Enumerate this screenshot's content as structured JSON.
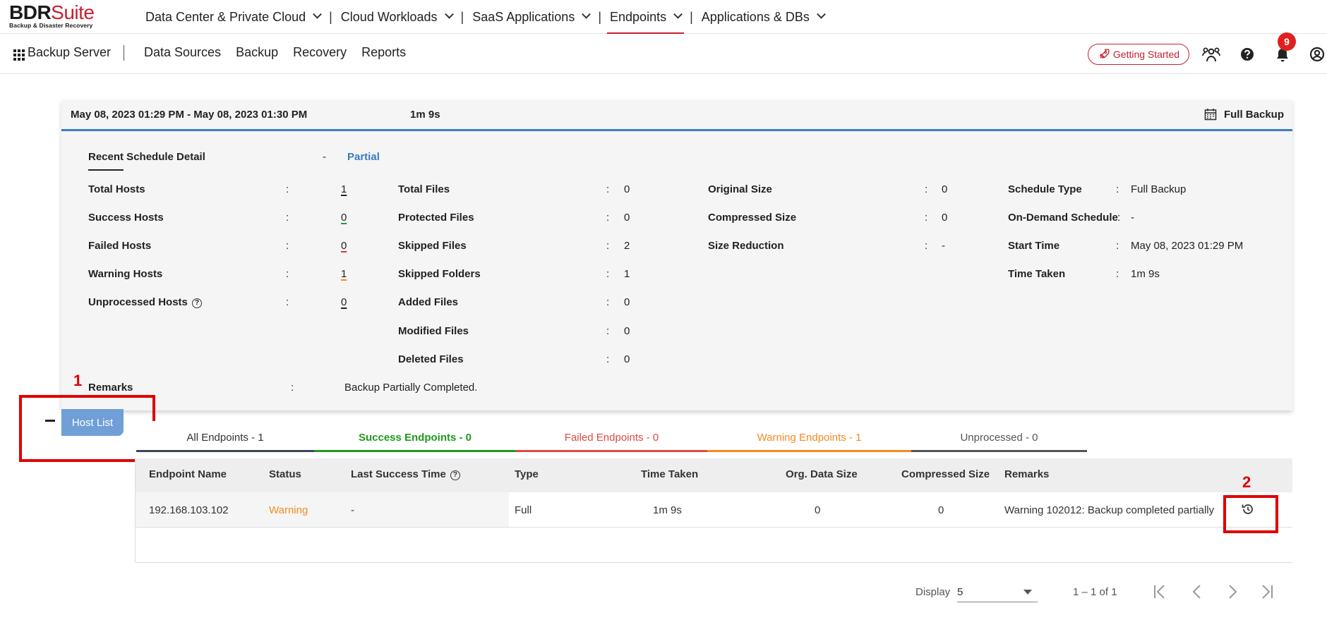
{
  "logo": {
    "bdr": "BDR",
    "suite": "Suite",
    "tagline": "Backup & Disaster Recovery"
  },
  "topnav": {
    "items": [
      {
        "label": "Data Center & Private Cloud"
      },
      {
        "label": "Cloud Workloads"
      },
      {
        "label": "SaaS Applications"
      },
      {
        "label": "Endpoints",
        "active": true
      },
      {
        "label": "Applications & DBs"
      }
    ],
    "separator": "|"
  },
  "subbar": {
    "server_label": "Backup Server",
    "items": [
      "Data Sources",
      "Backup",
      "Recovery",
      "Reports"
    ],
    "getting_started": "Getting Started",
    "notification_count": "9",
    "icons": [
      "apps-grid-icon",
      "users-icon",
      "help-icon",
      "bell-icon",
      "user-icon"
    ]
  },
  "job": {
    "range": "May 08, 2023 01:29 PM - May 08, 2023 01:30 PM",
    "duration": "1m 9s",
    "backup_type": "Full Backup"
  },
  "schedule": {
    "title": "Recent Schedule Detail",
    "dash": "-",
    "status": "Partial",
    "colon": ":",
    "col1": [
      {
        "label": "Total Hosts",
        "value": "1"
      },
      {
        "label": "Success Hosts",
        "value": "0"
      },
      {
        "label": "Failed Hosts",
        "value": "0"
      },
      {
        "label": "Warning Hosts",
        "value": "1"
      },
      {
        "label": "Unprocessed Hosts",
        "value": "0"
      }
    ],
    "col2": [
      {
        "label": "Total Files",
        "value": "0"
      },
      {
        "label": "Protected Files",
        "value": "0"
      },
      {
        "label": "Skipped Files",
        "value": "2"
      },
      {
        "label": "Skipped Folders",
        "value": "1"
      },
      {
        "label": "Added Files",
        "value": "0"
      },
      {
        "label": "Modified Files",
        "value": "0"
      },
      {
        "label": "Deleted Files",
        "value": "0"
      }
    ],
    "col3": [
      {
        "label": "Original Size",
        "value": "0"
      },
      {
        "label": "Compressed Size",
        "value": "0"
      },
      {
        "label": "Size Reduction",
        "value": "-"
      }
    ],
    "col4": [
      {
        "label": "Schedule Type",
        "value": "Full Backup"
      },
      {
        "label": "On-Demand Schedule",
        "value": "-"
      },
      {
        "label": "Start Time",
        "value": "May 08, 2023 01:29 PM"
      },
      {
        "label": "Time Taken",
        "value": "1m 9s"
      }
    ],
    "remarks_label": "Remarks",
    "remarks_value": "Backup Partially Completed."
  },
  "annotations": {
    "one": "1",
    "two": "2"
  },
  "host_list": {
    "label": "Host List"
  },
  "tabs": [
    {
      "label": "All Endpoints - 1",
      "color": "#333333",
      "bar": "#3d4656"
    },
    {
      "label": "Success Endpoints - 0",
      "color": "#1e9a1e",
      "bar": "#1e9a1e"
    },
    {
      "label": "Failed Endpoints - 0",
      "color": "#e04848",
      "bar": "#e04848"
    },
    {
      "label": "Warning Endpoints - 1",
      "color": "#f58a20",
      "bar": "#f58a20"
    },
    {
      "label": "Unprocessed - 0",
      "color": "#555555",
      "bar": "#555555"
    }
  ],
  "table": {
    "headers": [
      "Endpoint Name",
      "Status",
      "Last Success Time",
      "Type",
      "Time Taken",
      "Org. Data Size",
      "Compressed Size",
      "Remarks"
    ],
    "rows": [
      {
        "endpoint": "192.168.103.102",
        "status": "Warning",
        "last_success": "-",
        "type": "Full",
        "time_taken": "1m 9s",
        "org_size": "0",
        "compressed": "0",
        "remarks": "Warning 102012: Backup completed partially"
      }
    ]
  },
  "pager": {
    "display_label": "Display",
    "page_size": "5",
    "range": "1 – 1 of 1"
  },
  "colors": {
    "brand_red": "#c8202f",
    "accent_blue": "#3a7cc3",
    "warning_orange": "#f58a20"
  }
}
